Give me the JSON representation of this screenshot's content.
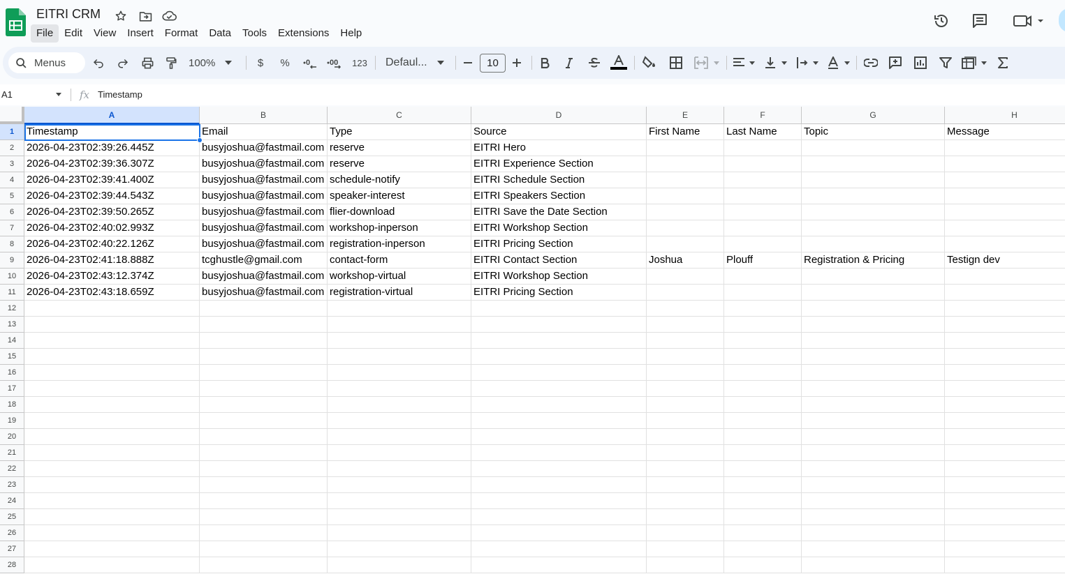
{
  "app": {
    "title": "EITRI CRM",
    "icons": [
      "star-icon",
      "move-to-folder-icon",
      "cloud-saved-icon",
      "version-history-icon",
      "comments-icon",
      "meet-camera-icon"
    ]
  },
  "menu": [
    "File",
    "Edit",
    "View",
    "Insert",
    "Format",
    "Data",
    "Tools",
    "Extensions",
    "Help"
  ],
  "toolbar": {
    "search_label": "Menus",
    "zoom": "100%",
    "currency": "$",
    "percent": "%",
    "decrease_decimal": ".0",
    "increase_decimal": ".00",
    "number_format": "123",
    "font": "Defaul...",
    "font_size": "10",
    "colors": {
      "text_color_bar": "#000000",
      "accent": "#1a73e8"
    }
  },
  "formula_bar": {
    "cell_ref": "A1",
    "fx": "fx",
    "value": "Timestamp"
  },
  "sheet": {
    "columns": [
      "A",
      "B",
      "C",
      "D",
      "E",
      "F",
      "G",
      "H"
    ],
    "row_numbers": [
      "1",
      "2",
      "3",
      "4",
      "5",
      "6",
      "7",
      "8",
      "9",
      "10",
      "11",
      "12",
      "13",
      "14",
      "15",
      "16",
      "17",
      "18",
      "19",
      "20",
      "21",
      "22",
      "23",
      "24",
      "25",
      "26",
      "27",
      "28"
    ],
    "header": [
      "Timestamp",
      "Email",
      "Type",
      "Source",
      "First  Name",
      "Last Name",
      "Topic",
      "Message"
    ],
    "rows": [
      [
        "2026-04-23T02:39:26.445Z",
        "busyjoshua@fastmail.com",
        "reserve",
        "EITRI Hero",
        "",
        "",
        "",
        ""
      ],
      [
        "2026-04-23T02:39:36.307Z",
        "busyjoshua@fastmail.com",
        "reserve",
        "EITRI Experience Section",
        "",
        "",
        "",
        ""
      ],
      [
        "2026-04-23T02:39:41.400Z",
        "busyjoshua@fastmail.com",
        "schedule-notify",
        "EITRI Schedule Section",
        "",
        "",
        "",
        ""
      ],
      [
        "2026-04-23T02:39:44.543Z",
        "busyjoshua@fastmail.com",
        "speaker-interest",
        "EITRI Speakers Section",
        "",
        "",
        "",
        ""
      ],
      [
        "2026-04-23T02:39:50.265Z",
        "busyjoshua@fastmail.com",
        "flier-download",
        "EITRI Save the Date Section",
        "",
        "",
        "",
        ""
      ],
      [
        "2026-04-23T02:40:02.993Z",
        "busyjoshua@fastmail.com",
        "workshop-inperson",
        "EITRI Workshop Section",
        "",
        "",
        "",
        ""
      ],
      [
        "2026-04-23T02:40:22.126Z",
        "busyjoshua@fastmail.com",
        "registration-inperson",
        "EITRI Pricing Section",
        "",
        "",
        "",
        ""
      ],
      [
        "2026-04-23T02:41:18.888Z",
        "tcghustle@gmail.com",
        "contact-form",
        "EITRI Contact Section",
        "Joshua",
        "Plouff",
        "Registration & Pricing",
        "Testign dev"
      ],
      [
        "2026-04-23T02:43:12.374Z",
        "busyjoshua@fastmail.com",
        "workshop-virtual",
        "EITRI Workshop Section",
        "",
        "",
        "",
        ""
      ],
      [
        "2026-04-23T02:43:18.659Z",
        "busyjoshua@fastmail.com",
        "registration-virtual",
        "EITRI Pricing Section",
        "",
        "",
        "",
        ""
      ]
    ],
    "selected_cell": "A1"
  }
}
